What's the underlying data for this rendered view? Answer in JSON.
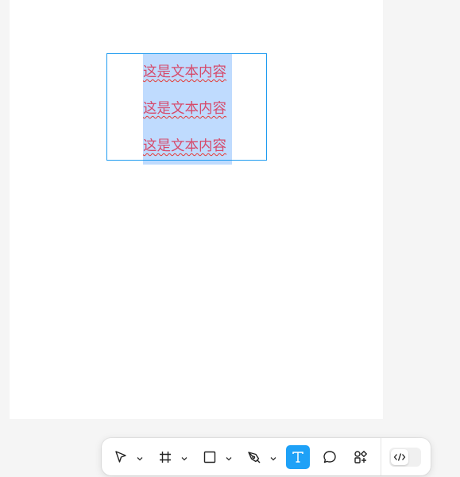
{
  "canvas": {
    "text_lines": [
      "这是文本内容",
      "这是文本内容",
      "这是文本内容"
    ]
  },
  "toolbar": {
    "tools": [
      {
        "name": "move-tool",
        "icon": "pointer-icon",
        "has_dropdown": true
      },
      {
        "name": "frame-tool",
        "icon": "hash-frame-icon",
        "has_dropdown": true
      },
      {
        "name": "rectangle-tool",
        "icon": "square-icon",
        "has_dropdown": true
      },
      {
        "name": "pen-tool",
        "icon": "pen-nib-icon",
        "has_dropdown": true
      },
      {
        "name": "text-tool",
        "icon": "text-t-icon",
        "active": true
      },
      {
        "name": "comment-tool",
        "icon": "speech-bubble-icon"
      },
      {
        "name": "resources-tool",
        "icon": "components-plus-icon"
      }
    ],
    "dev_mode": {
      "icon": "code-brackets-icon",
      "enabled": false
    }
  },
  "colors": {
    "accent": "#1ea1f7",
    "selection": "#bfdbfe",
    "text": "#d64a6b",
    "spellcheck": "#e53935"
  }
}
